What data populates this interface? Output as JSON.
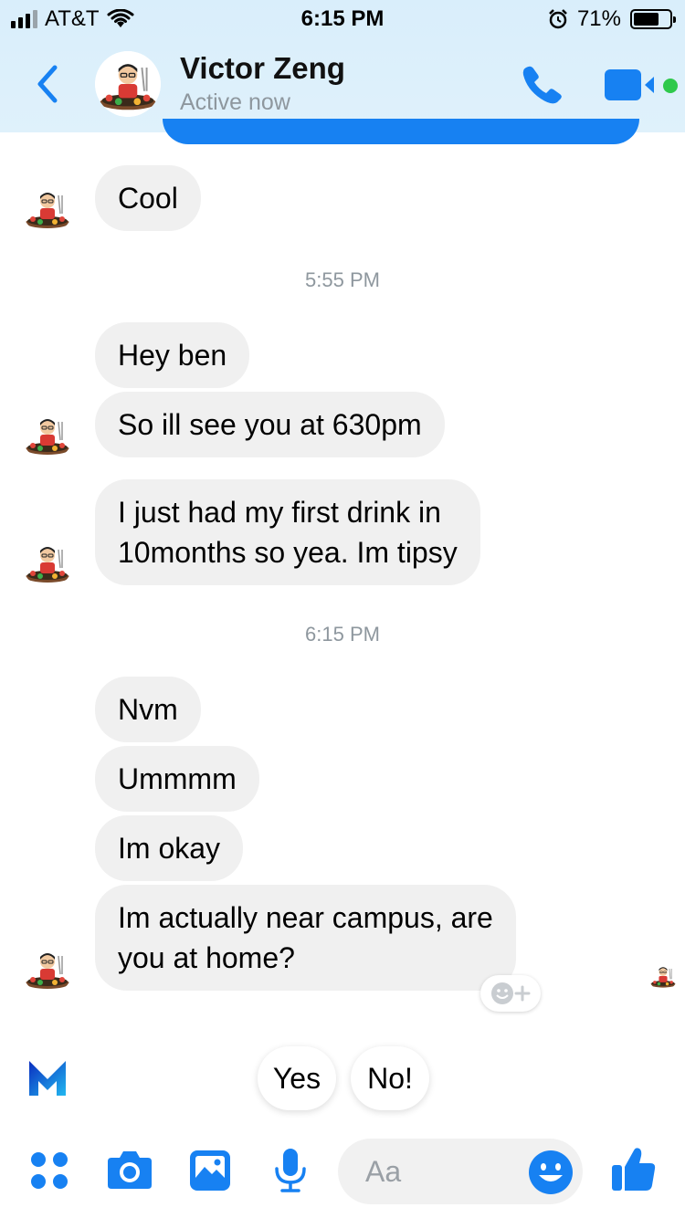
{
  "status_bar": {
    "carrier": "AT&T",
    "time": "6:15 PM",
    "battery_percent": "71%",
    "battery_level": 0.71,
    "signal_bars_full": 3,
    "signal_bars_total": 4
  },
  "header": {
    "contact_name": "Victor Zeng",
    "contact_status": "Active now",
    "accent_color": "#1781f2",
    "active_color": "#2ec94c"
  },
  "messages": {
    "m1": "Cool",
    "ts1": "5:55 PM",
    "m2": "Hey ben",
    "m3": "So ill see you at 630pm",
    "m4_line1": "I just had my first drink in",
    "m4_line2": "10months so yea. Im tipsy",
    "ts2": "6:15 PM",
    "m5": "Nvm",
    "m6": "Ummmm",
    "m7": "Im okay",
    "m8_line1": "Im actually near campus, are",
    "m8_line2": "you at home?"
  },
  "quick_replies": {
    "yes": "Yes",
    "no": "No!"
  },
  "composer": {
    "placeholder": "Aa",
    "value": ""
  },
  "icons": {
    "back": "chevron-left-icon",
    "call": "phone-icon",
    "video": "video-camera-icon",
    "apps": "grid-dots-icon",
    "camera": "camera-icon",
    "gallery": "image-icon",
    "mic": "microphone-icon",
    "emoji": "smiley-icon",
    "like": "thumbs-up-icon",
    "react": "add-reaction-icon",
    "assistant": "m-assistant-icon"
  }
}
